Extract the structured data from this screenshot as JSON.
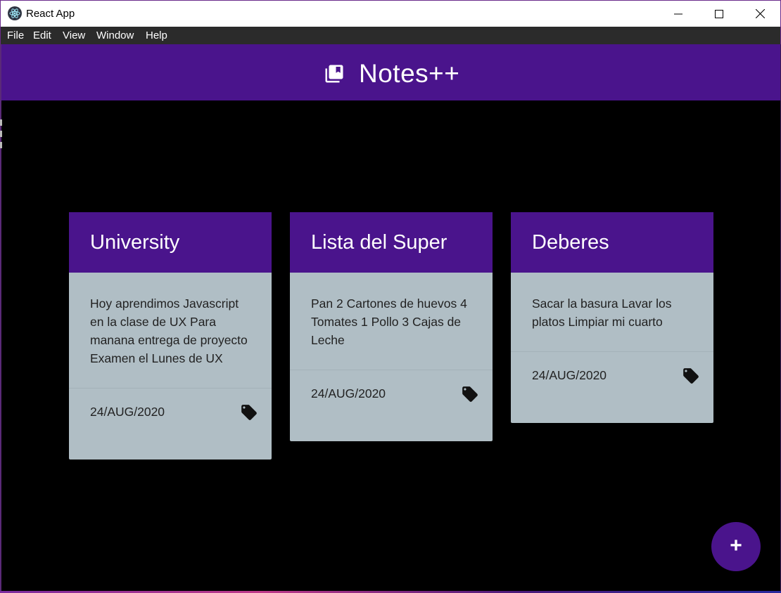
{
  "window": {
    "title": "React App"
  },
  "menu": {
    "items": [
      "File",
      "Edit",
      "View",
      "Window",
      "Help"
    ]
  },
  "header": {
    "title": "Notes++",
    "icon": "library-books-icon"
  },
  "notes": [
    {
      "title": "University",
      "body": "Hoy aprendimos Javascript en la clase de UX Para manana entrega de proyecto Examen el Lunes de UX",
      "date": "24/AUG/2020"
    },
    {
      "title": "Lista del Super",
      "body": "Pan 2 Cartones de huevos 4 Tomates 1 Pollo 3 Cajas de Leche",
      "date": "24/AUG/2020"
    },
    {
      "title": "Deberes",
      "body": "Sacar la basura Lavar los platos Limpiar mi cuarto",
      "date": "24/AUG/2020"
    }
  ],
  "fab": {
    "label": "+"
  },
  "colors": {
    "accent": "#4a148c",
    "card": "#b0bec5",
    "background": "#000000",
    "menubar": "#2b2b2b"
  }
}
